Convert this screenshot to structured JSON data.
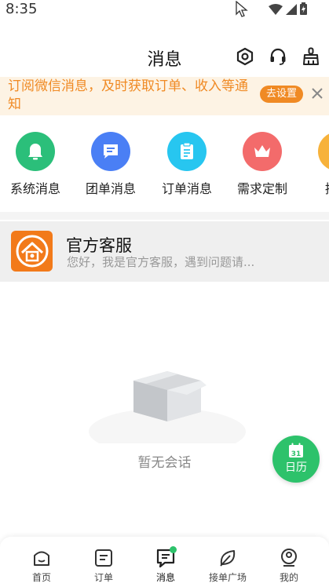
{
  "status_bar": {
    "time": "8:35"
  },
  "nav": {
    "title": "消息"
  },
  "banner": {
    "text": "订阅微信消息，及时获取订单、收入等通知",
    "button_label": "去设置"
  },
  "categories": [
    {
      "label": "系统消息",
      "color": "#2bbf7a",
      "icon": "bell-icon"
    },
    {
      "label": "团单消息",
      "color": "#4a7ff5",
      "icon": "chat-icon"
    },
    {
      "label": "订单消息",
      "color": "#27c6f0",
      "icon": "clipboard-icon"
    },
    {
      "label": "需求定制",
      "color": "#f36b6b",
      "icon": "crown-icon"
    },
    {
      "label": "拼单",
      "color": "#f7b23b",
      "icon": "group-icon"
    }
  ],
  "service": {
    "name": "官方客服",
    "preview": "您好，我是官方客服，遇到问题请..."
  },
  "empty": {
    "text": "暂无会话"
  },
  "calendar_fab": {
    "day": "31",
    "label": "日历"
  },
  "tabs": [
    {
      "label": "首页",
      "icon": "home-icon"
    },
    {
      "label": "订单",
      "icon": "order-icon"
    },
    {
      "label": "消息",
      "icon": "message-icon",
      "active": true
    },
    {
      "label": "接单广场",
      "icon": "leaf-icon"
    },
    {
      "label": "我的",
      "icon": "profile-icon"
    }
  ],
  "colors": {
    "accent_green": "#2dc26b",
    "banner_orange": "#f08a24",
    "banner_bg": "#fdf3e4",
    "service_avatar": "#f27a1a"
  }
}
